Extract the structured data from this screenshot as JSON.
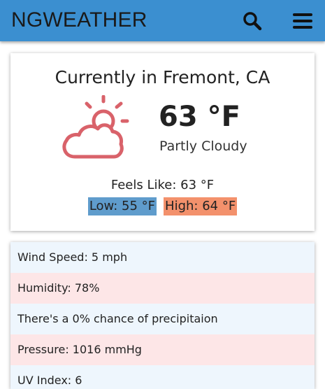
{
  "app": {
    "brand": "NGWEATHER"
  },
  "current": {
    "location_title": "Currently in Fremont, CA",
    "temperature": "63 °F",
    "condition": "Partly Cloudy",
    "feels_like": "Feels Like: 63 °F",
    "low": "Low: 55 °F",
    "high": "High: 64 °F",
    "icon": "partly-cloudy-icon"
  },
  "details": [
    "Wind Speed: 5 mph",
    "Humidity: 78%",
    "There's a 0% chance of precipitaion",
    "Pressure: 1016 mmHg",
    "UV Index: 6"
  ],
  "colors": {
    "navbar": "#3b8fd0",
    "icon": "#d9626a",
    "low_badge": "#5f9ccc",
    "high_badge": "#f3916c",
    "row_blue": "#eef6fd",
    "row_pink": "#fde6e7"
  }
}
